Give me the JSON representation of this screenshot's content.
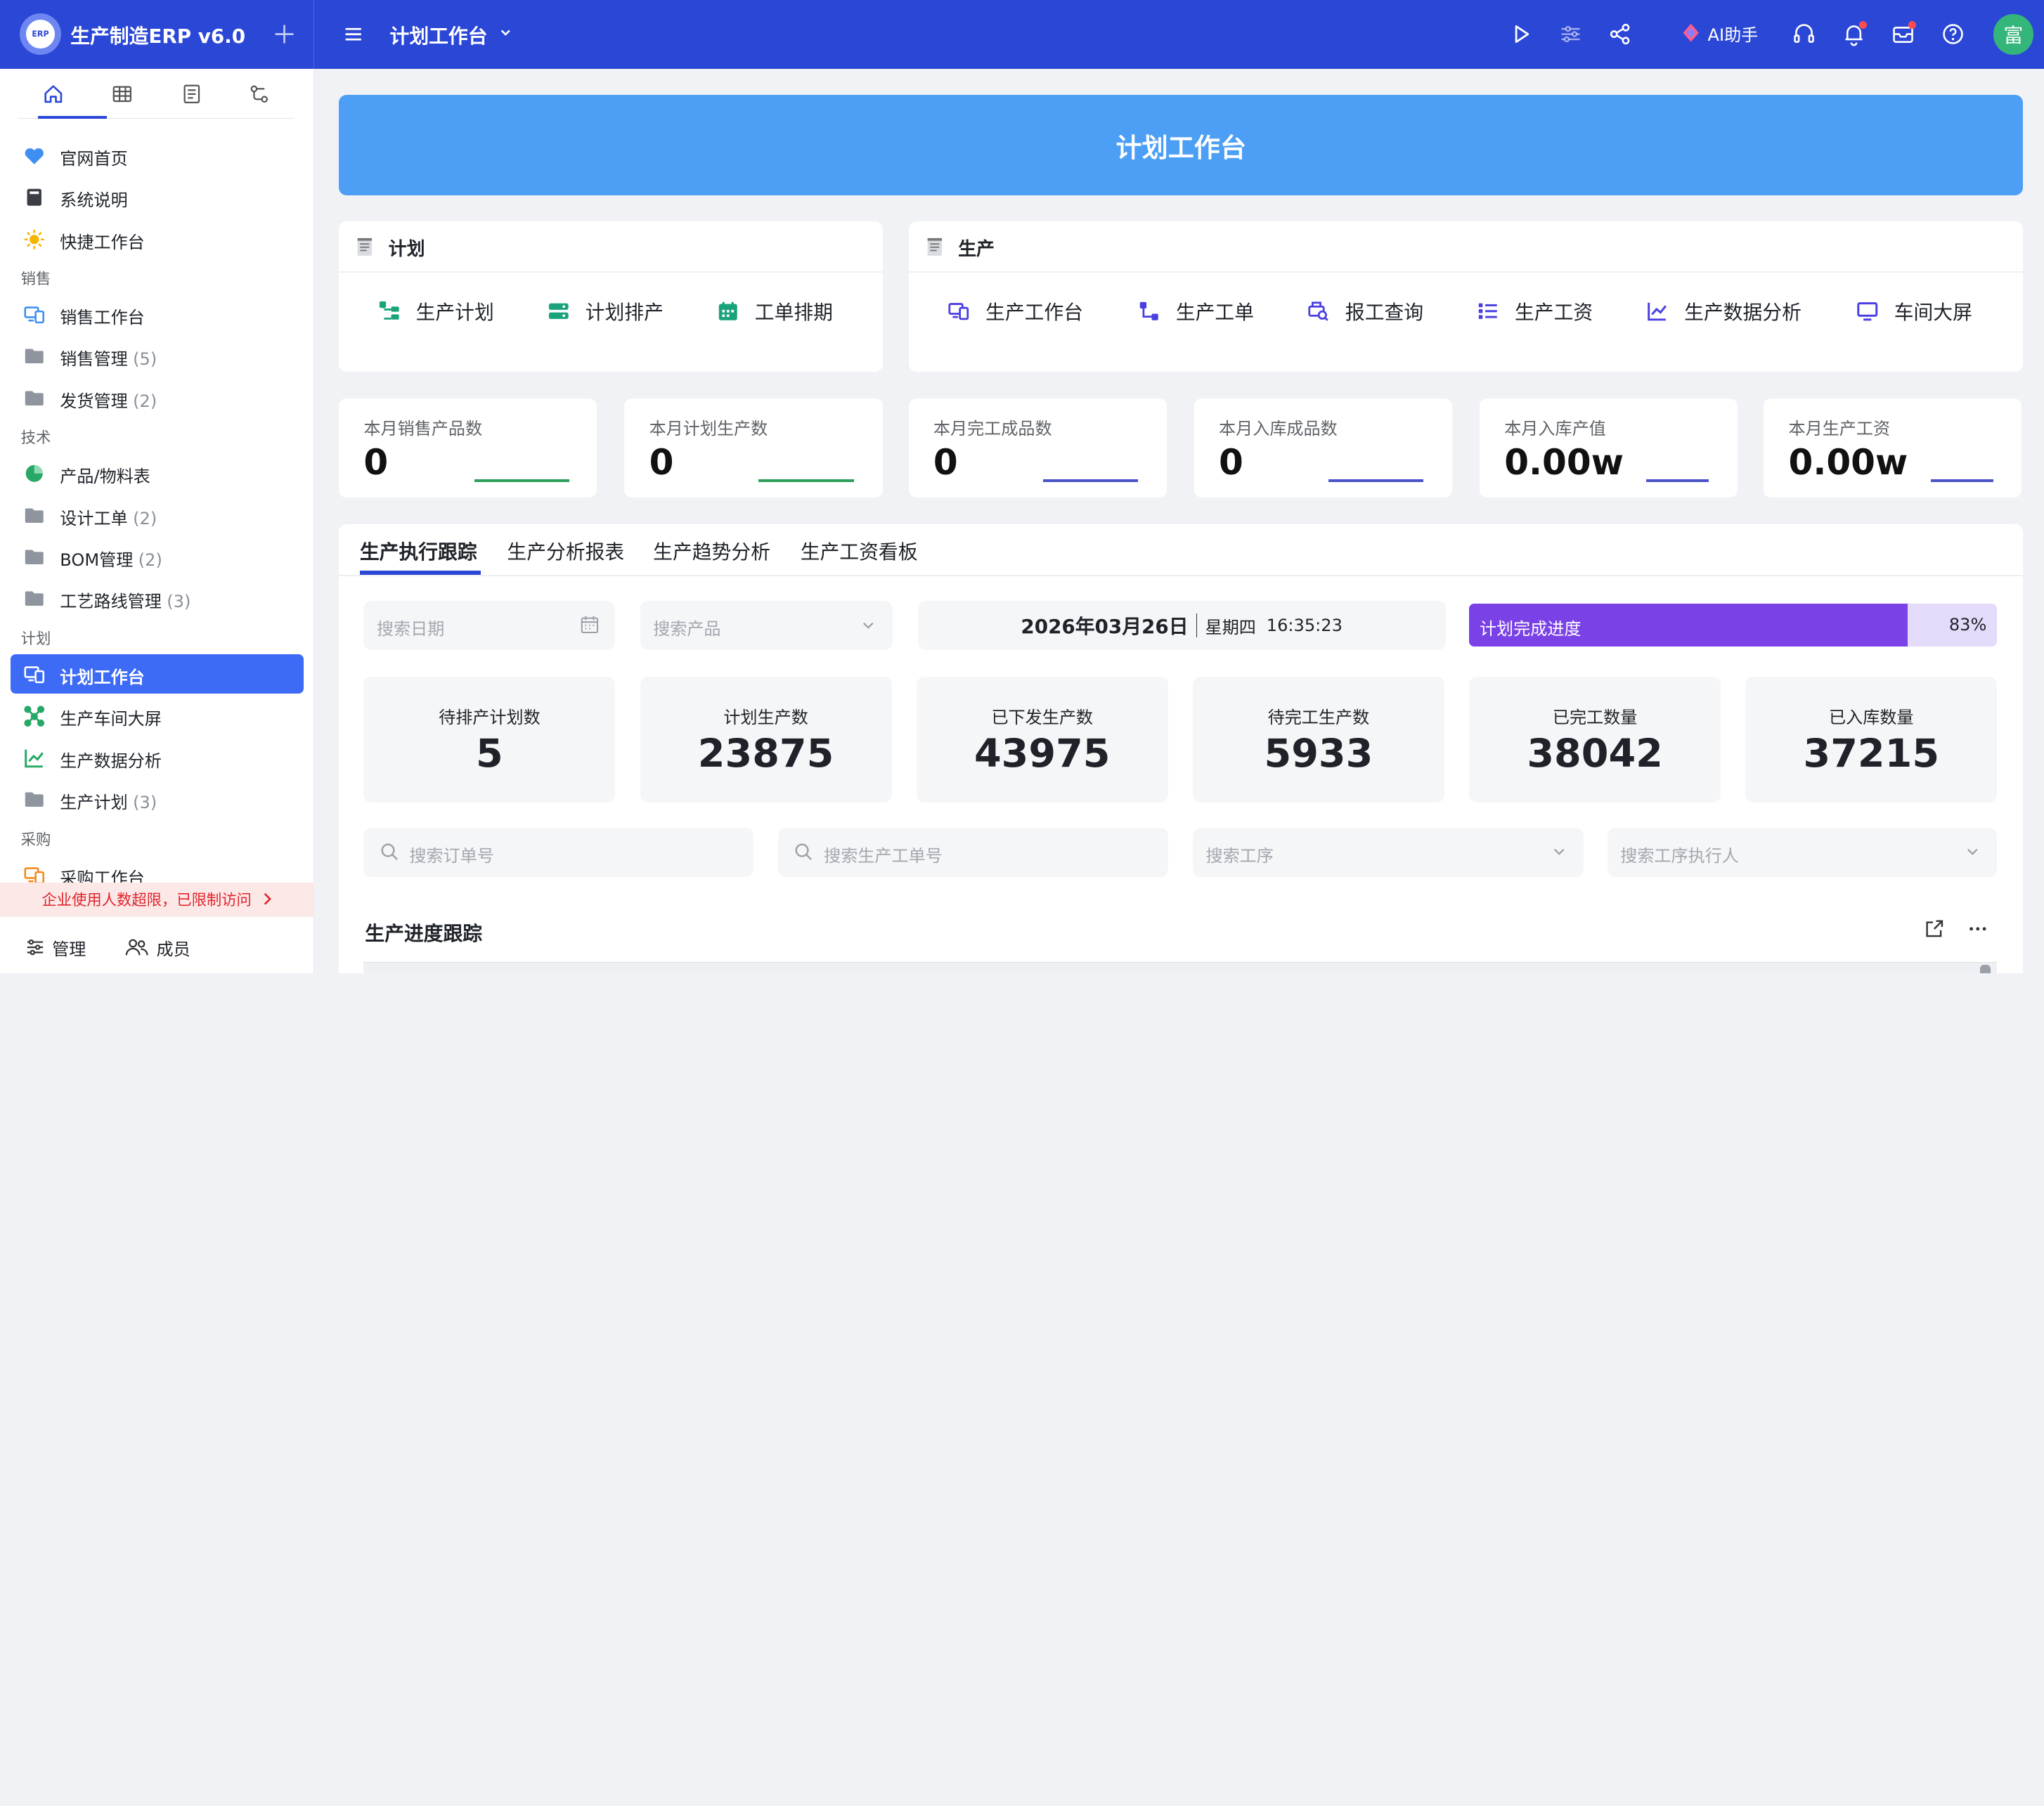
{
  "app": {
    "logo_text": "ERP",
    "name": "生产制造ERP v6.0",
    "page_title": "计划工作台",
    "ai_label": "AI助手",
    "avatar_text": "富"
  },
  "colors": {
    "topbar": "#2b47d6",
    "active_nav": "#3d6bf5",
    "banner": "#4c9ff5",
    "progress": "#7a42e6"
  },
  "sidebar": {
    "tabs": [
      "home-icon",
      "table-icon",
      "document-icon",
      "flow-icon"
    ],
    "groups": {
      "sales": "销售",
      "tech": "技术",
      "plan": "计划",
      "purchase": "采购"
    },
    "items": [
      {
        "label": "官网首页",
        "count": ""
      },
      {
        "label": "系统说明",
        "count": ""
      },
      {
        "label": "快捷工作台",
        "count": ""
      },
      {
        "label": "销售工作台",
        "count": ""
      },
      {
        "label": "销售管理",
        "count": "(5)"
      },
      {
        "label": "发货管理",
        "count": "(2)"
      },
      {
        "label": "产品/物料表",
        "count": ""
      },
      {
        "label": "设计工单",
        "count": "(2)"
      },
      {
        "label": "BOM管理",
        "count": "(2)"
      },
      {
        "label": "工艺路线管理",
        "count": "(3)"
      },
      {
        "label": "计划工作台",
        "count": ""
      },
      {
        "label": "生产车间大屏",
        "count": ""
      },
      {
        "label": "生产数据分析",
        "count": ""
      },
      {
        "label": "生产计划",
        "count": "(3)"
      },
      {
        "label": "采购工作台",
        "count": ""
      }
    ],
    "limit_notice": "企业使用人数超限，已限制访问",
    "footer": {
      "manage": "管理",
      "members": "成员"
    }
  },
  "banner": {
    "title": "计划工作台"
  },
  "plan_card": {
    "title": "计划",
    "items": [
      "生产计划",
      "计划排产",
      "工单排期"
    ]
  },
  "prod_card": {
    "title": "生产",
    "items": [
      "生产工作台",
      "生产工单",
      "报工查询",
      "生产工资",
      "生产数据分析",
      "车间大屏"
    ]
  },
  "stats": [
    {
      "label": "本月销售产品数",
      "value": "0"
    },
    {
      "label": "本月计划生产数",
      "value": "0"
    },
    {
      "label": "本月完工成品数",
      "value": "0"
    },
    {
      "label": "本月入库成品数",
      "value": "0"
    },
    {
      "label": "本月入库产值",
      "value": "0.00w"
    },
    {
      "label": "本月生产工资",
      "value": "0.00w"
    }
  ],
  "tabs": [
    "生产执行跟踪",
    "生产分析报表",
    "生产趋势分析",
    "生产工资看板"
  ],
  "filters": {
    "date_placeholder": "搜索日期",
    "product_placeholder": "搜索产品",
    "order_placeholder": "搜索订单号",
    "work_order_placeholder": "搜索生产工单号",
    "process_placeholder": "搜索工序",
    "executor_placeholder": "搜索工序执行人"
  },
  "datetime": {
    "date": "2026年03月26日",
    "weekday": "星期四",
    "time": "16:35:23"
  },
  "progress": {
    "label": "计划完成进度",
    "value": "83%",
    "fraction": 0.83
  },
  "kpis": [
    {
      "label": "待排产计划数",
      "value": "5"
    },
    {
      "label": "计划生产数",
      "value": "23875"
    },
    {
      "label": "已下发生产数",
      "value": "43975"
    },
    {
      "label": "待完工生产数",
      "value": "5933"
    },
    {
      "label": "已完工数量",
      "value": "38042"
    },
    {
      "label": "已入库数量",
      "value": "37215"
    }
  ],
  "section": {
    "title": "生产进度跟踪"
  }
}
